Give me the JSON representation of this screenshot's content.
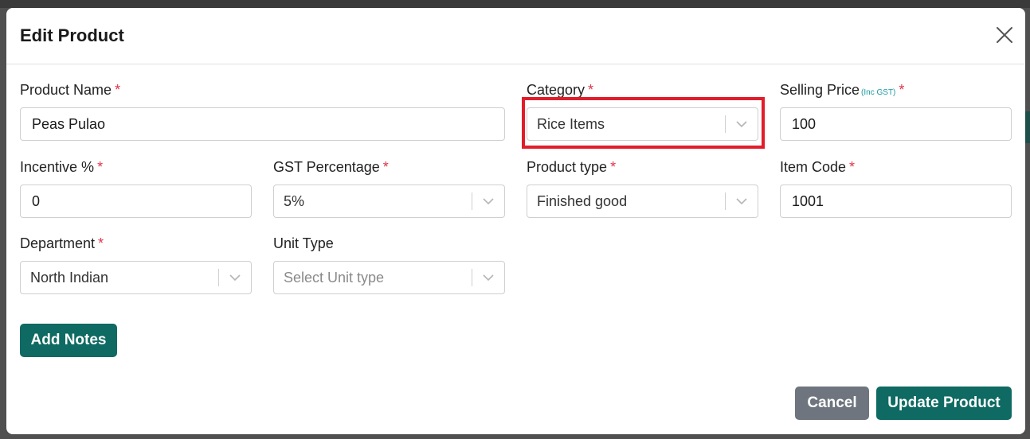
{
  "modal": {
    "title": "Edit Product",
    "close_icon": "close-icon"
  },
  "form": {
    "product_name": {
      "label": "Product Name",
      "required": "*",
      "value": "Peas Pulao"
    },
    "category": {
      "label": "Category",
      "required": "*",
      "value": "Rice Items",
      "highlighted": true,
      "highlight_color": "#e11d2b"
    },
    "selling_price": {
      "label": "Selling Price",
      "hint": "(Inc GST)",
      "required": "*",
      "value": "100"
    },
    "incentive": {
      "label": "Incentive %",
      "required": "*",
      "value": "0"
    },
    "gst_percentage": {
      "label": "GST Percentage",
      "required": "*",
      "value": "5%"
    },
    "product_type": {
      "label": "Product type",
      "required": "*",
      "value": "Finished good"
    },
    "item_code": {
      "label": "Item Code",
      "required": "*",
      "value": "1001"
    },
    "department": {
      "label": "Department",
      "required": "*",
      "value": "North Indian"
    },
    "unit_type": {
      "label": "Unit Type",
      "placeholder": "Select Unit type"
    }
  },
  "buttons": {
    "add_notes": "Add Notes",
    "cancel": "Cancel",
    "update_product": "Update Product"
  },
  "colors": {
    "primary": "#0e6a62",
    "cancel": "#6e757e",
    "required": "#e0344a",
    "hint": "#1a9aa0"
  }
}
